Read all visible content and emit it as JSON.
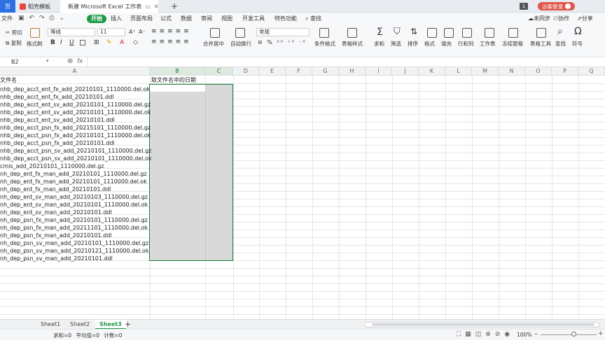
{
  "titlebar": {
    "home_tab": "页",
    "template_tab": "稻壳模板",
    "workbook_tab": "新建 Microsoft Excel 工作表",
    "new_tab": "+",
    "page_count": "1",
    "login_button": "访客登录"
  },
  "menubar": {
    "items": [
      "文件",
      "开始",
      "插入",
      "页面布局",
      "公式",
      "数据",
      "审阅",
      "视图",
      "开发工具",
      "特色功能"
    ],
    "search": "查找",
    "sync": "未同步",
    "collab": "协作",
    "share": "分享"
  },
  "ribbon": {
    "cut": "剪切",
    "copy": "复制",
    "format_painter": "格式刷",
    "font_name": "等线",
    "font_size": "11",
    "merge_center": "合并居中",
    "wrap_text": "自动换行",
    "number_format": "常规",
    "conditional_format": "条件格式",
    "table_style": "表格样式",
    "sum": "求和",
    "filter": "筛选",
    "sort": "排序",
    "format": "格式",
    "fill": "填充",
    "row_col": "行和列",
    "worksheet": "工作表",
    "freeze": "冻结窗格",
    "table_tools": "表格工具",
    "find": "查找",
    "symbol": "符号"
  },
  "formula_bar": {
    "name_box": "B2",
    "fx": "fx",
    "value": ""
  },
  "grid": {
    "columns": [
      "A",
      "B",
      "C",
      "D",
      "E",
      "F",
      "G",
      "H",
      "I",
      "J",
      "K",
      "L",
      "M",
      "N",
      "O",
      "P",
      "Q"
    ],
    "header_a": "文件名",
    "header_b": "取文件名中的日期",
    "rows": [
      "nhb_dep_acct_ent_fx_add_20210101_1110000.del.ok",
      "nhb_dep_acct_ent_fx_add_20210101.ddl",
      "nhb_dep_acct_ent_sv_add_20210101_1110000.del.gz",
      "nhb_dep_acct_ent_sv_add_20210101_1110000.del.ok",
      "nhb_dep_acct_ent_sv_add_20210101.ddl",
      "nhb_dep_acct_psn_fx_add_20215101_1110000.del.gz",
      "nhb_dep_acct_psn_fx_add_20210101_1110000.del.ok",
      "nhb_dep_acct_psn_fx_add_20210101.ddl",
      "nhb_dep_acct_psn_sv_add_20210101_1110000.del.gz",
      "nhb_dep_acct_psn_sv_add_20210101_1110000.del.ok",
      "cmis_add_20210101_1110000.del.gz",
      "nh_dep_ent_fx_man_add_20210101_1110000.del.gz",
      "nh_dep_ent_fx_man_add_20210101_1110000.del.ok",
      "nh_dep_ent_fx_man_add_20210101.ddl",
      "nh_dep_ent_sv_man_add_20210103_1110000.del.gz",
      "nh_dep_ent_sv_man_add_20210101_1110000.del.ok",
      "nh_dep_ent_sv_man_add_20210101.ddl",
      "nh_dep_psn_fx_man_add_20210101_1110000.del.gz",
      "nh_dep_psn_fx_man_add_20211101_1110000.del.ok",
      "nh_dep_psn_fx_man_add_20210101.ddl",
      "nh_dep_psn_sv_man_add_20210101_1110000.del.gz",
      "nh_dep_psn_sv_man_add_20210121_1110000.del.ok",
      "nh_dep_psn_sv_man_add_20210101.ddl"
    ]
  },
  "sheets": [
    "Sheet1",
    "Sheet2",
    "Sheet3"
  ],
  "active_sheet": "Sheet3",
  "add_sheet": "+",
  "statusbar": {
    "sum": "求和=0",
    "average": "平均值=0",
    "count": "计数=0",
    "zoom": "100%"
  },
  "colors": {
    "accent": "#1f9a49",
    "selection_fill": "#d9d9d9",
    "selection_border": "#1d7a3c"
  }
}
